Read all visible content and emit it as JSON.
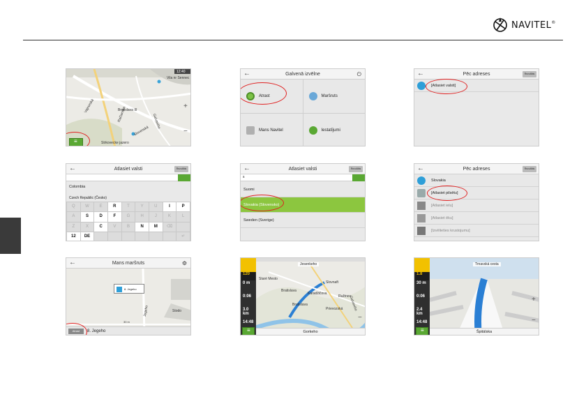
{
  "brand": {
    "name": "NAVITEL",
    "reg": "®"
  },
  "panel1": {
    "labels": [
      "Vila nr Sennec",
      "Bratislava III",
      "Vajnorská",
      "Račianska",
      "Galvaniho",
      "Slovenská",
      "Strkovecke jazero"
    ],
    "status": "12:40"
  },
  "panel2": {
    "title": "Galvenā izvēlne",
    "tiles": [
      "Atrast",
      "Maršruts",
      "Mans Navitel",
      "Iestatījumi"
    ]
  },
  "panel3": {
    "title": "Pēc adreses",
    "btn": "Rezultāts",
    "rows": [
      "[Atlasiet valsti]"
    ]
  },
  "panel4": {
    "title": "Atlasiet valsti",
    "btn": "Rezultāts",
    "rows": [
      "Colombia",
      "Czech Republic (Česko)"
    ],
    "keys": [
      "Q",
      "W",
      "E",
      "R",
      "T",
      "Y",
      "U",
      "I",
      "P",
      "A",
      "S",
      "D",
      "F",
      "G",
      "H",
      "J",
      "K",
      "L",
      "Z",
      "X",
      "C",
      "V",
      "B",
      "N",
      "M",
      "⌫",
      "",
      "12",
      "DE",
      "",
      "",
      "",
      "",
      "",
      "",
      "↵"
    ]
  },
  "panel5": {
    "title": "Atlasiet valsti",
    "btn": "Rezultāts",
    "search": "s",
    "rows": [
      "Suomi",
      "Slovakia (Slovensko)",
      "Sweden (Sverige)"
    ]
  },
  "panel6": {
    "title": "Pēc adreses",
    "btn": "Rezultāts",
    "rows": [
      "Slovakia",
      "[Atlasiet pilsētu]",
      "[Atlasiet ielu]",
      "[Atlasiet ēku]",
      "[Izvēlieties krustojumu]"
    ]
  },
  "panel7": {
    "title": "Mans maršruts",
    "popup": "8. Jegeho",
    "footer": "8. Jegeho",
    "go": "Atrast",
    "labels": [
      "Jegeho",
      "Stodo",
      "30 m"
    ]
  },
  "panel8": {
    "top": "Jesenkeho",
    "footer": "Gorkeho",
    "speed": "120",
    "cells": [
      "0 m",
      "0:06",
      "3.0 km",
      "14:48"
    ],
    "labels": [
      "Staré Mesto",
      "Bratislava",
      "Karadžičova",
      "Ružinov",
      "Slovnaft",
      "Prievozská",
      "Bratislava",
      "Galvaniho"
    ]
  },
  "panel9": {
    "top": "Trnavská cesta",
    "footer": "Špitálska",
    "speed": "1.8",
    "cells": [
      "30 m",
      "0:06",
      "2.4 km",
      "14:48"
    ]
  }
}
